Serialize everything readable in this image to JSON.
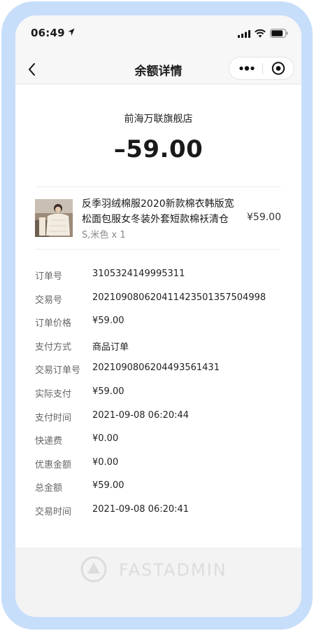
{
  "status_bar": {
    "time": "06:49"
  },
  "nav": {
    "title": "余额详情"
  },
  "order": {
    "shop_name": "前海万联旗舰店",
    "amount": "–59.00"
  },
  "product": {
    "title": "反季羽绒棉服2020新款棉衣韩版宽松面包服女冬装外套短款棉袄清仓",
    "price": "¥59.00",
    "spec": "S,米色 x 1"
  },
  "details": [
    {
      "label": "订单号",
      "value": "3105324149995311"
    },
    {
      "label": "交易号",
      "value": "202109080620411423501357504998"
    },
    {
      "label": "订单价格",
      "value": "¥59.00"
    },
    {
      "label": "支付方式",
      "value": "商品订单"
    },
    {
      "label": "交易订单号",
      "value": "2021090806204493561431"
    },
    {
      "label": "实际支付",
      "value": "¥59.00"
    },
    {
      "label": "支付时间",
      "value": "2021-09-08 06:20:44"
    },
    {
      "label": "快递费",
      "value": "¥0.00"
    },
    {
      "label": "优惠金额",
      "value": "¥0.00"
    },
    {
      "label": "总金额",
      "value": "¥59.00"
    },
    {
      "label": "交易时间",
      "value": "2021-09-08 06:20:41"
    }
  ],
  "watermark": {
    "text": "FASTADMIN"
  },
  "icons": {
    "location": "location-arrow-icon",
    "signal": "cellular-signal-icon",
    "wifi": "wifi-icon",
    "battery": "battery-icon",
    "back": "chevron-left-icon",
    "more": "more-dots-icon",
    "close": "target-close-icon"
  },
  "colors": {
    "frame": "#c7defb",
    "screen_bg": "#f3f3f4",
    "card_bg": "#ffffff"
  }
}
